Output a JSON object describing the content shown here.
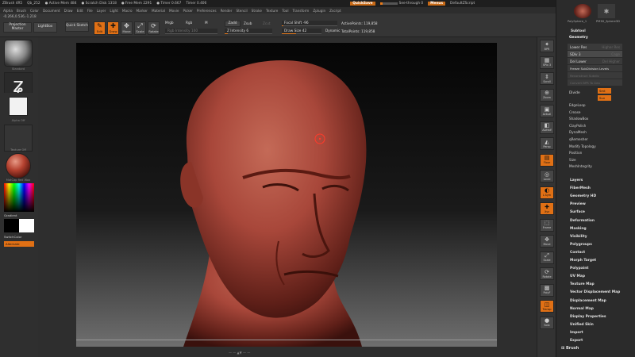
{
  "titlebar": {
    "app": "ZBrush 4R5",
    "file": "Qb_252",
    "items": [
      "● Active Mem 484",
      "● Scratch Disk 1318",
      "● Free Mem 2291",
      "● Timer 0.667",
      "Timer 0.406"
    ],
    "quicksave": "QuickSave",
    "seethrough": "See-through  0",
    "seethrough_level": 0,
    "menus_label": "Menus",
    "script_label": "DefaultZScript"
  },
  "menubar": [
    "Alpha",
    "Brush",
    "Color",
    "Document",
    "Draw",
    "Edit",
    "File",
    "Layer",
    "Light",
    "Macro",
    "Marker",
    "Material",
    "Movie",
    "Picker",
    "Preferences",
    "Render",
    "Stencil",
    "Stroke",
    "Texture",
    "Tool",
    "Transform",
    "Zplugin",
    "Zscript"
  ],
  "toolbar": {
    "projection_master": "Projection Master",
    "lightbox": "LightBox",
    "quick_sketch": "Quick Sketch",
    "coords": "-0.266,0.536,-1.218",
    "tools": [
      {
        "label": "Edit",
        "glyph": "✎",
        "active": true
      },
      {
        "label": "Draw",
        "glyph": "✚",
        "active": true
      },
      {
        "label": "Move",
        "glyph": "✥",
        "active": false
      },
      {
        "label": "Scale",
        "glyph": "⤢",
        "active": false
      },
      {
        "label": "Rotate",
        "glyph": "⟳",
        "active": false
      }
    ],
    "mrgb": "Mrgb",
    "rgb": "Rgb",
    "m": "M",
    "zadd": "Zadd",
    "zsub": "Zsub",
    "zcut": "Zcut",
    "rgb_intensity": "Rgb Intensity 100",
    "z_intensity": "Z Intensity 6",
    "z_intensity_value": 6,
    "focal_shift": "Focal Shift -96",
    "focal_shift_value": -96,
    "draw_size": "Draw Size 42",
    "draw_size_value": 42,
    "dynamic": "Dynamic",
    "active_points": "ActivePoints: 119,858",
    "total_points": "TotalPoints: 119,858"
  },
  "leftshelf": {
    "items": [
      "Standard",
      "Dots",
      "Alpha Off",
      "Texture Off",
      "MatCap Red Wax"
    ],
    "gradient": "Gradient",
    "switch_color": "SwitchColor",
    "alternate": "Alternate"
  },
  "dock": [
    "BPR",
    "SPix 3",
    "Scroll",
    "Zoom",
    "Actual",
    "AAHalf",
    "Persp",
    "Floor",
    "Local",
    "L.Sym",
    "Xyz",
    "Frame",
    "Move",
    "Scale",
    "Rotate",
    "PolyF",
    "Transp",
    "Solo"
  ],
  "rightpanel": {
    "subtools": [
      "PolySphere_1",
      "PM3D_Sphere3D"
    ],
    "subtool_label": "Subtool",
    "geometry": "Geometry",
    "lower_res": "Lower Res",
    "higher_res": "Higher Res",
    "sdiv": "SDiv 3",
    "cage": "Cage",
    "del_lower": "Del Lower",
    "del_higher": "Del Higher",
    "freeze_subdiv": "Freeze SubDivision Levels",
    "reconstruct": "Reconstruct Subdiv",
    "convert_bpr": "Convert BPR To Geo",
    "divide": "Divide",
    "smt": "Smt",
    "suv": "Suv",
    "sub_items": [
      "EdgeLoop",
      "Crease",
      "ShadowBox",
      "ClayPolish",
      "DynaMesh",
      "qRemesher",
      "Modify Topology",
      "Position",
      "Size",
      "MeshIntegrity"
    ],
    "menu_items": [
      "Layers",
      "FiberMesh",
      "Geometry HD",
      "Preview",
      "Surface",
      "Deformation",
      "Masking",
      "Visibility",
      "Polygroups",
      "Contact",
      "Morph Target",
      "Polypaint",
      "UV Map",
      "Texture Map",
      "Vector Displacement Map",
      "Displacement Map",
      "Normal Map",
      "Display Properties",
      "Unified Skin",
      "Import",
      "Export"
    ],
    "brush": "Brush"
  },
  "canvas_bottom": "— — ▲▼ — —"
}
